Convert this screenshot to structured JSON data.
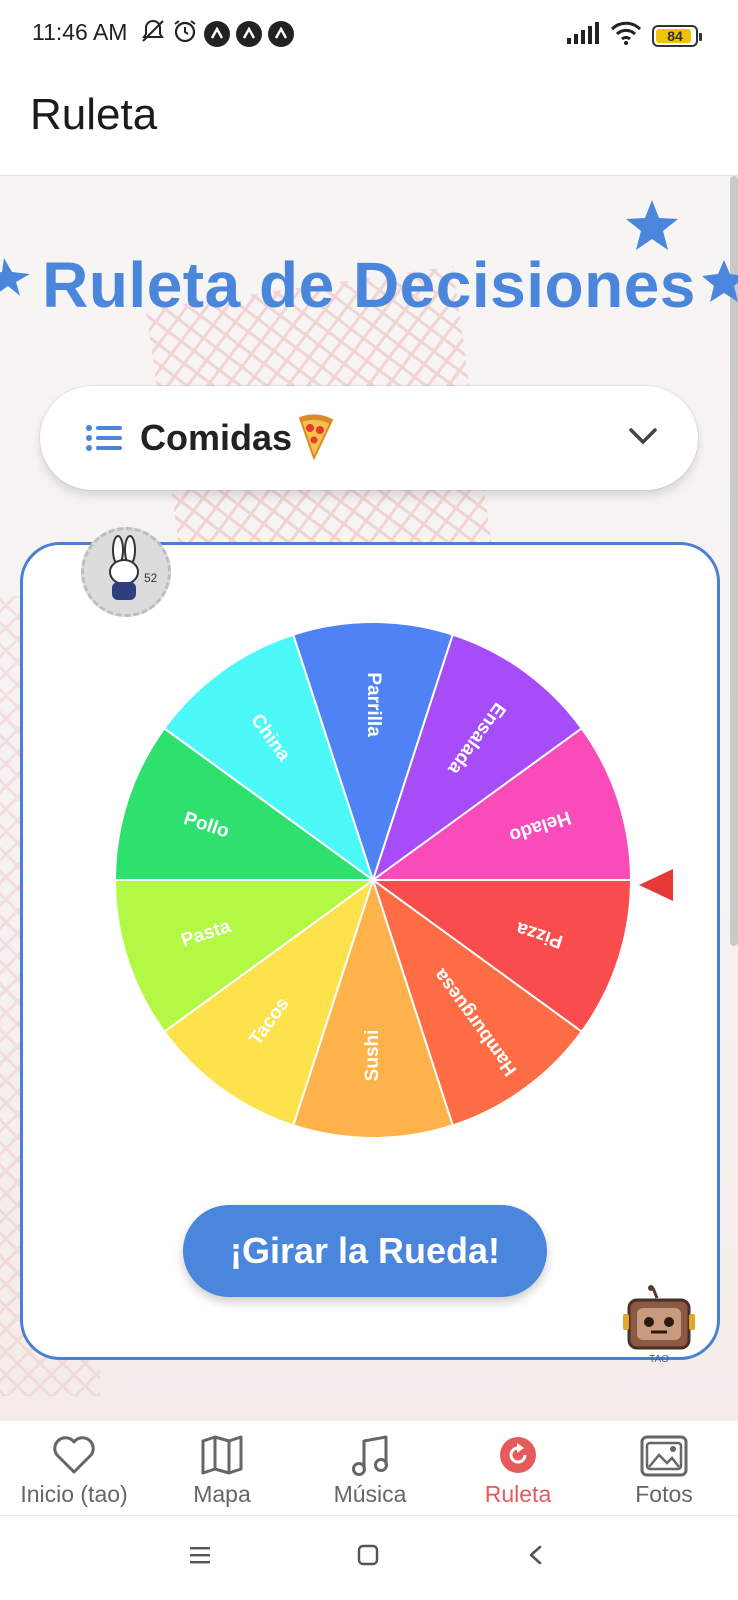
{
  "status_bar": {
    "time": "11:46 AM",
    "battery": "84"
  },
  "app_bar": {
    "title": "Ruleta"
  },
  "main": {
    "heading": "Ruleta de Decisiones",
    "selector": {
      "label": "Comidas",
      "emoji": "🍕"
    },
    "wheel": {
      "segments": [
        {
          "label": "Pizza",
          "color": "#f94d4d"
        },
        {
          "label": "Hamburguesa",
          "color": "#fd6c44"
        },
        {
          "label": "Sushi",
          "color": "#fdb34a"
        },
        {
          "label": "Tacos",
          "color": "#fde24b"
        },
        {
          "label": "Pasta",
          "color": "#b2f845"
        },
        {
          "label": "Pollo",
          "color": "#2ee16f"
        },
        {
          "label": "China",
          "color": "#4df8f8"
        },
        {
          "label": "Parrilla",
          "color": "#4e82f5"
        },
        {
          "label": "Ensalada",
          "color": "#a64cf8"
        },
        {
          "label": "Helado",
          "color": "#f94cba"
        }
      ],
      "pointer_color": "#e53935"
    },
    "spin_button": "¡Girar la Rueda!",
    "stamp_number": "52",
    "mascot_label": "TAO"
  },
  "bottom_nav": {
    "items": [
      {
        "label": "Inicio (tao)",
        "icon": "heart-icon"
      },
      {
        "label": "Mapa",
        "icon": "map-icon"
      },
      {
        "label": "Música",
        "icon": "music-icon"
      },
      {
        "label": "Ruleta",
        "icon": "refresh-icon",
        "active": true
      },
      {
        "label": "Fotos",
        "icon": "photos-icon"
      }
    ],
    "active_color": "#e55a5a"
  },
  "colors": {
    "accent": "#4a86db",
    "card_border": "#4a80d2"
  }
}
